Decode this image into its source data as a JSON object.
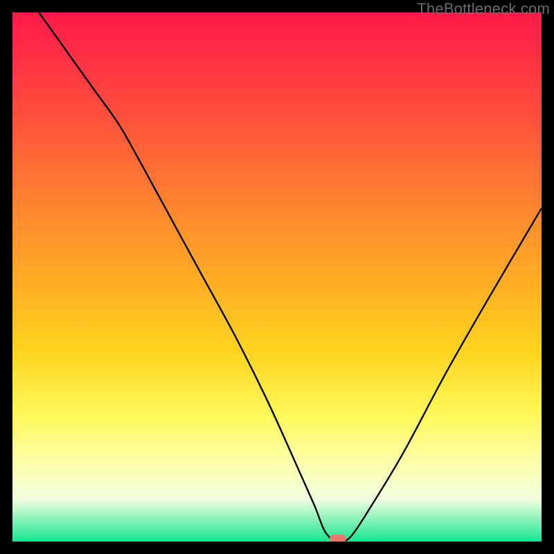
{
  "watermark": "TheBottleneck.com",
  "colors": {
    "frame": "#000000",
    "curve": "#000000",
    "marker": "#e97a6f",
    "gradient_stops": [
      {
        "pos": 0.0,
        "color": "#ff1a4a"
      },
      {
        "pos": 0.15,
        "color": "#ff4240"
      },
      {
        "pos": 0.4,
        "color": "#ff8f2d"
      },
      {
        "pos": 0.64,
        "color": "#ffd420"
      },
      {
        "pos": 0.85,
        "color": "#fdffaa"
      },
      {
        "pos": 1.0,
        "color": "#17e58f"
      }
    ]
  },
  "chart_data": {
    "type": "line",
    "title": "",
    "xlabel": "",
    "ylabel": "",
    "xlim": [
      0,
      100
    ],
    "ylim": [
      0,
      100
    ],
    "grid": false,
    "legend": false,
    "series": [
      {
        "name": "bottleneck-curve",
        "x": [
          5,
          10,
          15,
          20,
          24,
          30,
          36,
          42,
          48,
          53,
          57,
          59,
          61,
          62,
          64,
          68,
          74,
          82,
          90,
          100
        ],
        "y": [
          100,
          93,
          86,
          79,
          72,
          61,
          50,
          39,
          27,
          16,
          7,
          2,
          0,
          0,
          1,
          7,
          17,
          32,
          46,
          63
        ]
      }
    ],
    "annotations": [
      {
        "name": "min-marker",
        "x": 61.5,
        "y": 0,
        "shape": "pill",
        "color": "#e97a6f"
      }
    ]
  }
}
